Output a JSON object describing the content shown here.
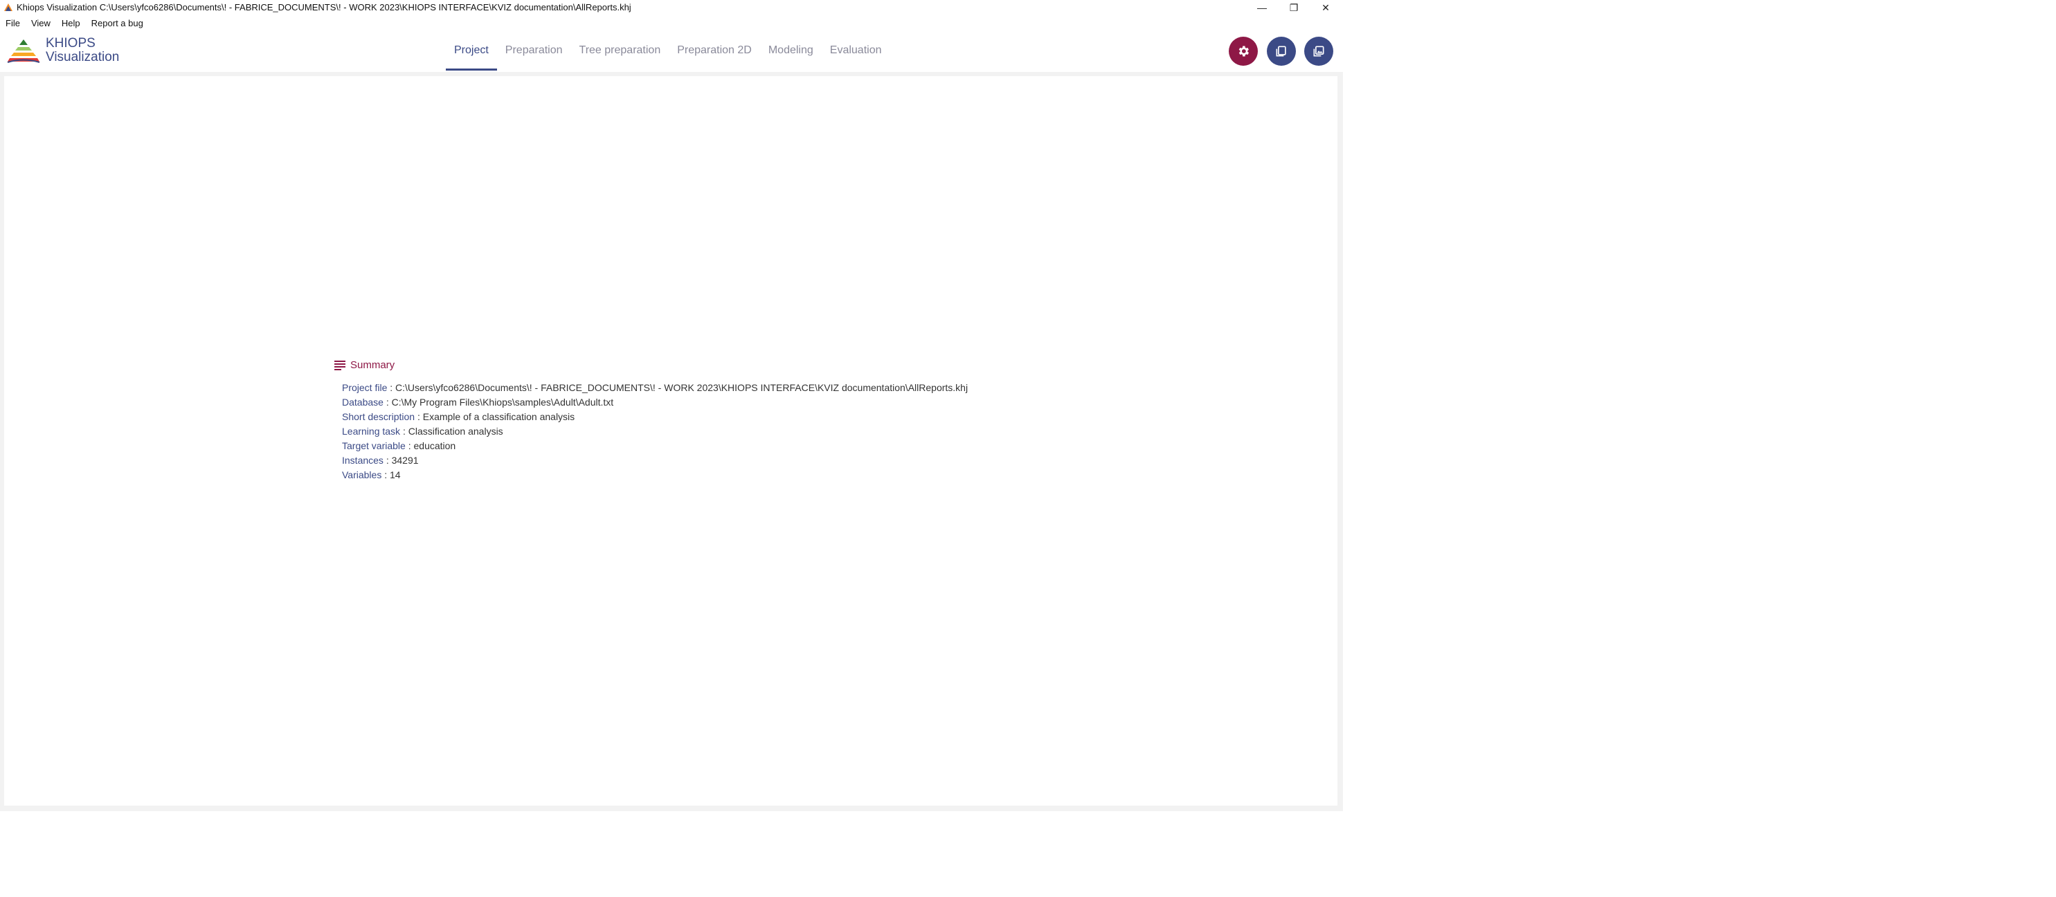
{
  "window": {
    "title": "Khiops Visualization C:\\Users\\yfco6286\\Documents\\! - FABRICE_DOCUMENTS\\! - WORK 2023\\KHIOPS INTERFACE\\KVIZ documentation\\AllReports.khj",
    "minimize_glyph": "—",
    "restore_glyph": "❐",
    "close_glyph": "✕"
  },
  "menu": [
    "File",
    "View",
    "Help",
    "Report a bug"
  ],
  "logo": {
    "line1": "KHIOPS",
    "line2": "Visualization"
  },
  "tabs": [
    {
      "label": "Project",
      "active": true
    },
    {
      "label": "Preparation",
      "active": false
    },
    {
      "label": "Tree preparation",
      "active": false
    },
    {
      "label": "Preparation 2D",
      "active": false
    },
    {
      "label": "Modeling",
      "active": false
    },
    {
      "label": "Evaluation",
      "active": false
    }
  ],
  "header_buttons": [
    {
      "icon": "gear-icon",
      "color": "#8e1846"
    },
    {
      "icon": "open-file-icon",
      "color": "#3b4a86"
    },
    {
      "icon": "image-snapshot-icon",
      "color": "#3b4a86"
    }
  ],
  "summary": {
    "title": "Summary",
    "rows": [
      {
        "key": "Project file",
        "value": "C:\\Users\\yfco6286\\Documents\\! - FABRICE_DOCUMENTS\\! - WORK 2023\\KHIOPS INTERFACE\\KVIZ documentation\\AllReports.khj"
      },
      {
        "key": "Database",
        "value": "C:\\My Program Files\\Khiops\\samples\\Adult\\Adult.txt"
      },
      {
        "key": "Short description",
        "value": "Example of a classification analysis"
      },
      {
        "key": "Learning task",
        "value": "Classification analysis"
      },
      {
        "key": "Target variable",
        "value": "education"
      },
      {
        "key": "Instances",
        "value": "34291"
      },
      {
        "key": "Variables",
        "value": "14"
      }
    ],
    "separator": " : "
  },
  "colors": {
    "primary": "#3b4a86",
    "accent": "#8e1846",
    "inactive_tab": "#8a8a9a"
  }
}
